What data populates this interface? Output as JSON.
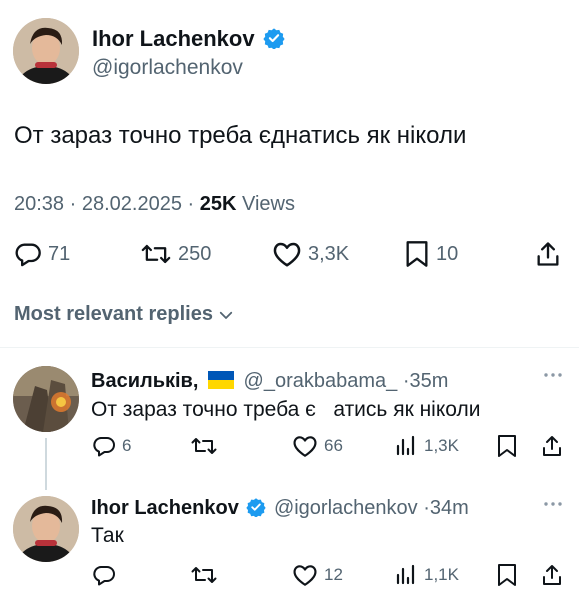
{
  "main_tweet": {
    "author_name": "Ihor Lachenkov",
    "author_handle": "@igorlachenkov",
    "text": "От зараз точно треба єднатись як ніколи",
    "time": "20:38",
    "date": "28.02.2025",
    "views_count": "25K",
    "views_label": "Views",
    "replies": "71",
    "retweets": "250",
    "likes": "3,3K",
    "bookmarks": "10"
  },
  "replies_sort": {
    "label": "Most relevant replies"
  },
  "reply_1": {
    "author_name": "Васильків,",
    "author_handle": "@_orakbabama_",
    "time": "35m",
    "text": "От зараз точно треба є   атись як ніколи",
    "replies": "6",
    "likes": "66",
    "views": "1,3K"
  },
  "reply_2": {
    "author_name": "Ihor Lachenkov",
    "author_handle": "@igorlachenkov",
    "time": "34m",
    "text": "Так",
    "likes": "12",
    "views": "1,1K"
  },
  "colors": {
    "verified": "#1d9bf0",
    "text_primary": "#0f1419",
    "text_secondary": "#536471",
    "flag_blue": "#0057b7",
    "flag_yellow": "#ffd700"
  }
}
